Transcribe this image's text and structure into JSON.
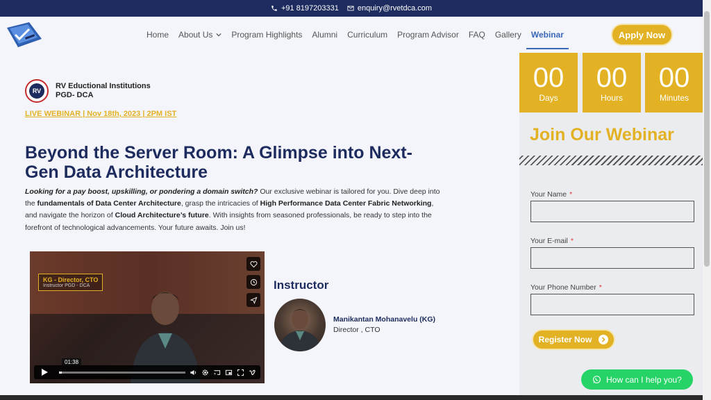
{
  "topbar": {
    "phone": "+91 8197203331",
    "email": "enquiry@rvetdca.com"
  },
  "nav": {
    "items": [
      {
        "label": "Home"
      },
      {
        "label": "About Us"
      },
      {
        "label": "Program Highlights"
      },
      {
        "label": "Alumni"
      },
      {
        "label": "Curriculum"
      },
      {
        "label": "Program Advisor"
      },
      {
        "label": "FAQ"
      },
      {
        "label": "Gallery"
      },
      {
        "label": "Webinar"
      }
    ],
    "active": "Webinar",
    "apply_label": "Apply Now"
  },
  "brand": {
    "seal_text": "RV",
    "name": "RV Eductional Institutions",
    "program": "PGD- DCA"
  },
  "event": {
    "live_text": "LIVE WEBINAR | Nov 18th, 2023 | 2PM IST"
  },
  "hero": {
    "title": "Beyond the Server Room: A Glimpse into Next-Gen Data Architecture",
    "intro": {
      "p1": "Looking for a pay boost, upskilling, or pondering a domain switch?",
      "p2": " Our exclusive webinar is tailored for you. Dive deep into the ",
      "p3": "fundamentals of Data Center Architecture",
      "p4": ", grasp the intricacies of ",
      "p5": "High Performance Data Center Fabric Networking",
      "p6": ", and navigate the horizon of ",
      "p7": "Cloud Architecture’s future",
      "p8": ". With insights from seasoned professionals, be ready to step into the forefront of technological advancements. Your future awaits. Join us!"
    }
  },
  "video": {
    "label_title": "KG - Director, CTO",
    "label_sub": "Instructor PGD - DCA",
    "time": "01:38",
    "progress": 0.02
  },
  "instructor": {
    "heading": "Instructor",
    "name": "Manikantan Mohanavelu (KG)",
    "role": "Director , CTO"
  },
  "countdown": [
    {
      "value": "00",
      "unit": "Days"
    },
    {
      "value": "00",
      "unit": "Hours"
    },
    {
      "value": "00",
      "unit": "Minutes"
    }
  ],
  "form": {
    "heading": "Join Our Webinar",
    "fields": [
      {
        "label": "Your Name",
        "required": "*"
      },
      {
        "label": "Your E-mail",
        "required": "*"
      },
      {
        "label": "Your Phone Number",
        "required": "*"
      }
    ],
    "submit_label": "Register Now"
  },
  "chat": {
    "label": "How can I help you?"
  },
  "colors": {
    "navy": "#1d2b5e",
    "gold": "#e3b124",
    "link_active": "#3b67b8",
    "whatsapp": "#25d366"
  }
}
